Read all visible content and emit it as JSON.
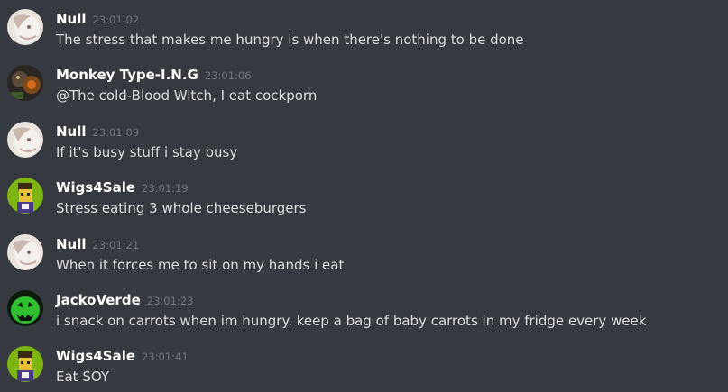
{
  "colors": {
    "background": "#36393f",
    "author": "#ffffff",
    "timestamp": "#72767d",
    "message_text": "#dcddde"
  },
  "messages": [
    {
      "author": "Null",
      "time": "23:01:02",
      "text": "The stress that makes me hungry is when there's nothing to be done",
      "avatar": "null-avatar"
    },
    {
      "author": "Monkey Type-I.N.G",
      "time": "23:01:06",
      "text": "@The cold-Blood Witch, I eat cockporn",
      "avatar": "monkey-avatar"
    },
    {
      "author": "Null",
      "time": "23:01:09",
      "text": "If it's busy stuff i stay busy",
      "avatar": "null-avatar"
    },
    {
      "author": "Wigs4Sale",
      "time": "23:01:19",
      "text": "Stress eating 3 whole cheeseburgers",
      "avatar": "wigs-avatar"
    },
    {
      "author": "Null",
      "time": "23:01:21",
      "text": "When it forces me to sit on my hands i eat",
      "avatar": "null-avatar"
    },
    {
      "author": "JackoVerde",
      "time": "23:01:23",
      "text": "i snack on carrots when im hungry. keep a bag of baby carrots in my fridge every week",
      "avatar": "jack-o-lantern-avatar"
    },
    {
      "author": "Wigs4Sale",
      "time": "23:01:41",
      "text": "Eat SOY",
      "avatar": "wigs-avatar"
    }
  ]
}
